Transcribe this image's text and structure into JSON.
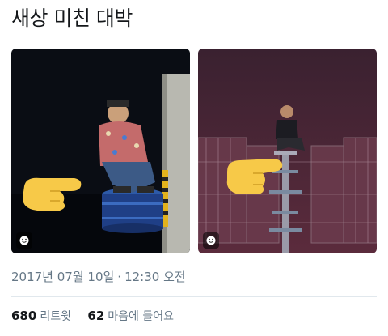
{
  "tweet": {
    "text": "새상 미친 대박",
    "timestamp_date": "2017년 07월 10일",
    "timestamp_separator": "·",
    "timestamp_time": "12:30 오전"
  },
  "photos": [
    {
      "alt_icon": "smiley-icon",
      "overlay_icon": "pointing-hand-icon"
    },
    {
      "alt_icon": "smiley-icon",
      "overlay_icon": "pointing-hand-icon"
    }
  ],
  "stats": {
    "retweets_count": "680",
    "retweets_label": "리트윗",
    "likes_count": "62",
    "likes_label": "마음에 들어요"
  },
  "colors": {
    "text": "#14171a",
    "secondary": "#657786",
    "divider": "#e1e8ed",
    "emoji_yellow": "#f7c948"
  }
}
